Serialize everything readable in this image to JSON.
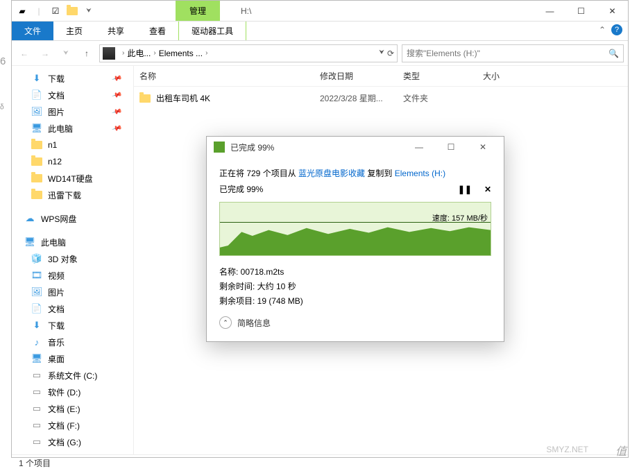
{
  "titlebar": {
    "context_tab": "管理",
    "title": "H:\\"
  },
  "ribbon": {
    "file": "文件",
    "home": "主页",
    "share": "共享",
    "view": "查看",
    "drive_tools": "驱动器工具"
  },
  "address": {
    "crumb1": "此电...",
    "crumb2": "Elements ..."
  },
  "search": {
    "placeholder": "搜索\"Elements (H:)\""
  },
  "sidebar": {
    "downloads": "下载",
    "documents": "文档",
    "pictures": "图片",
    "thispc_quick": "此电脑",
    "n1": "n1",
    "n12": "n12",
    "wd14t": "WD14T硬盘",
    "xunlei": "迅雷下载",
    "wps": "WPS网盘",
    "thispc": "此电脑",
    "objects3d": "3D 对象",
    "videos": "视频",
    "pictures2": "图片",
    "documents2": "文档",
    "downloads2": "下载",
    "music": "音乐",
    "desktop": "桌面",
    "sysdrive": "系统文件 (C:)",
    "soft_d": "软件 (D:)",
    "doc_e": "文档 (E:)",
    "doc_f": "文档 (F:)",
    "doc_g": "文档 (G:)"
  },
  "columns": {
    "name": "名称",
    "date": "修改日期",
    "type": "类型",
    "size": "大小"
  },
  "files": {
    "row0": {
      "name": "出租车司机 4K",
      "date": "2022/3/28 星期...",
      "type": "文件夹"
    }
  },
  "statusbar": {
    "count": "1 个项目"
  },
  "dialog": {
    "title": "已完成 99%",
    "copy_prefix": "正在将 729 个项目从 ",
    "source": "蓝光原盘电影收藏",
    "copy_mid": " 复制到 ",
    "dest": "Elements (H:)",
    "progress": "已完成 99%",
    "speed_label": "速度: 157 MB/秒",
    "name_label": "名称: ",
    "name_value": "00718.m2ts",
    "time_label": "剩余时间: ",
    "time_value": "大约 10 秒",
    "remain_label": "剩余项目: ",
    "remain_value": "19 (748 MB)",
    "more": "简略信息"
  },
  "watermark": "值",
  "watermark_smyz": "SMYZ.NET"
}
